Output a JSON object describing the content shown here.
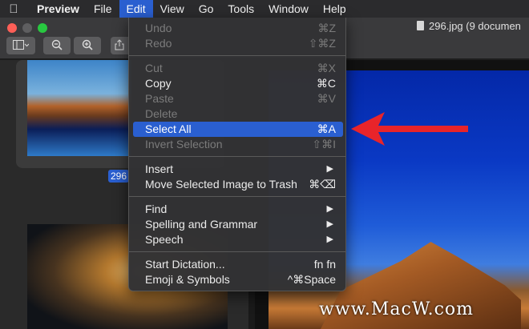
{
  "menubar": {
    "app_name": "Preview",
    "items": [
      "File",
      "Edit",
      "View",
      "Go",
      "Tools",
      "Window",
      "Help"
    ]
  },
  "window": {
    "title": "296.jpg (9 documen"
  },
  "sidebar": {
    "selected_thumbnail_label": "296"
  },
  "edit_menu": {
    "items": [
      {
        "label": "Undo",
        "shortcut": "⌘Z",
        "enabled": false
      },
      {
        "label": "Redo",
        "shortcut": "⇧⌘Z",
        "enabled": false
      },
      {
        "label": "Cut",
        "shortcut": "⌘X",
        "enabled": false
      },
      {
        "label": "Copy",
        "shortcut": "⌘C",
        "enabled": true
      },
      {
        "label": "Paste",
        "shortcut": "⌘V",
        "enabled": false
      },
      {
        "label": "Delete",
        "shortcut": "",
        "enabled": false
      },
      {
        "label": "Select All",
        "shortcut": "⌘A",
        "enabled": true,
        "highlighted": true
      },
      {
        "label": "Invert Selection",
        "shortcut": "⇧⌘I",
        "enabled": false
      },
      {
        "label": "Insert",
        "submenu": true,
        "enabled": true
      },
      {
        "label": "Move Selected Image to Trash",
        "shortcut": "⌘⌫",
        "enabled": true
      },
      {
        "label": "Find",
        "submenu": true,
        "enabled": true
      },
      {
        "label": "Spelling and Grammar",
        "submenu": true,
        "enabled": true
      },
      {
        "label": "Speech",
        "submenu": true,
        "enabled": true
      },
      {
        "label": "Start Dictation...",
        "shortcut": "fn fn",
        "enabled": true
      },
      {
        "label": "Emoji & Symbols",
        "shortcut": "^⌘Space",
        "enabled": true
      }
    ]
  },
  "watermark": "www.MacW.com",
  "colors": {
    "highlight": "#2a5fd0",
    "annotation_arrow": "#e8242a"
  }
}
